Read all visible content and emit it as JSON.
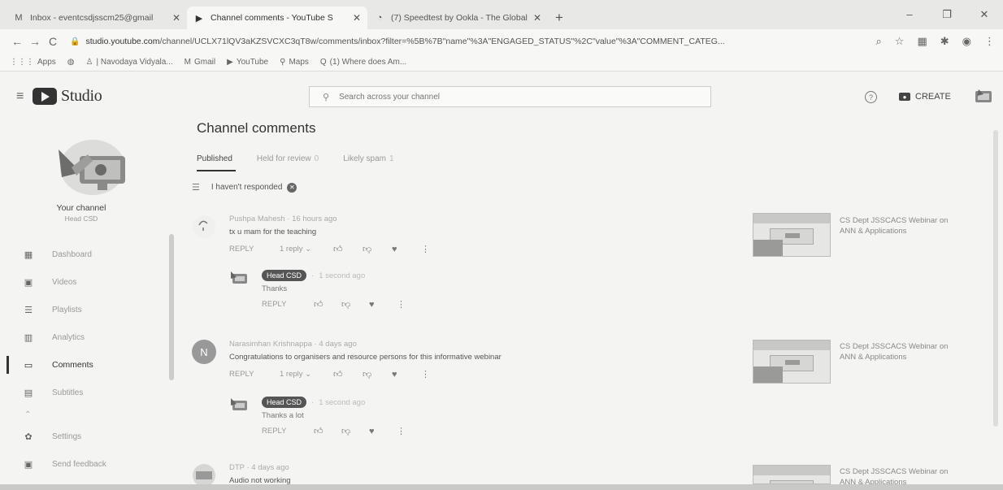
{
  "browser": {
    "tabs": [
      {
        "icon": "gmail-icon",
        "label": "Inbox - eventcsdjsscm25@gmail",
        "active": false
      },
      {
        "icon": "youtube-icon",
        "label": "Channel comments - YouTube S",
        "active": true
      },
      {
        "icon": "speedtest-icon",
        "label": "(7) Speedtest by Ookla - The Global",
        "active": false
      }
    ],
    "url_domain": "studio.youtube.com",
    "url_path": "/channel/UCLX71lQV3aKZSVCXC3qT8w/comments/inbox?filter=%5B%7B\"name\"%3A\"ENGAGED_STATUS\"%2C\"value\"%3A\"COMMENT_CATEG...",
    "bookmarks": [
      {
        "icon": "apps-icon",
        "label": "Apps"
      },
      {
        "icon": "globe-icon",
        "label": ""
      },
      {
        "icon": "school-icon",
        "label": "| Navodaya Vidyala..."
      },
      {
        "icon": "gmail-icon",
        "label": "Gmail"
      },
      {
        "icon": "youtube-icon",
        "label": "YouTube"
      },
      {
        "icon": "maps-icon",
        "label": "Maps"
      },
      {
        "icon": "quora-icon",
        "label": "(1) Where does Am..."
      }
    ]
  },
  "header": {
    "logo_text": "Studio",
    "search_placeholder": "Search across your channel",
    "create_label": "CREATE"
  },
  "sidebar": {
    "channel_label": "Your channel",
    "channel_name": "Head CSD",
    "items": [
      {
        "icon": "dashboard-icon",
        "label": "Dashboard"
      },
      {
        "icon": "videos-icon",
        "label": "Videos"
      },
      {
        "icon": "playlists-icon",
        "label": "Playlists"
      },
      {
        "icon": "analytics-icon",
        "label": "Analytics"
      },
      {
        "icon": "comments-icon",
        "label": "Comments"
      },
      {
        "icon": "subtitles-icon",
        "label": "Subtitles"
      },
      {
        "icon": "settings-icon",
        "label": "Settings"
      },
      {
        "icon": "feedback-icon",
        "label": "Send feedback"
      }
    ],
    "active_item": "Comments"
  },
  "main": {
    "title": "Channel comments",
    "tabs": [
      {
        "label": "Published",
        "count": ""
      },
      {
        "label": "Held for review",
        "count": "0"
      },
      {
        "label": "Likely spam",
        "count": "1"
      }
    ],
    "filter_chip": "I haven't responded",
    "comments": [
      {
        "author": "Pushpa Mahesh",
        "time": "16 hours ago",
        "text": "tx u mam for the teaching",
        "reply_label": "REPLY",
        "replies_label": "1 reply",
        "reply": {
          "badge": "Head CSD",
          "time": "1 second ago",
          "text": "Thanks",
          "reply_label": "REPLY"
        },
        "video_title": "CS Dept JSSCACS Webinar on ANN & Applications"
      },
      {
        "author": "Narasimhan Krishnappa",
        "avatar_letter": "N",
        "time": "4 days ago",
        "text": "Congratulations to organisers and resource persons  for this informative webinar",
        "reply_label": "REPLY",
        "replies_label": "1 reply",
        "reply": {
          "badge": "Head CSD",
          "time": "1 second ago",
          "text": "Thanks a lot",
          "reply_label": "REPLY"
        },
        "video_title": "CS Dept JSSCACS Webinar on ANN & Applications"
      },
      {
        "author": "DTP",
        "time": "4 days ago",
        "text": "Audio not working",
        "video_title": "CS Dept JSSCACS Webinar on ANN & Applications"
      }
    ]
  }
}
